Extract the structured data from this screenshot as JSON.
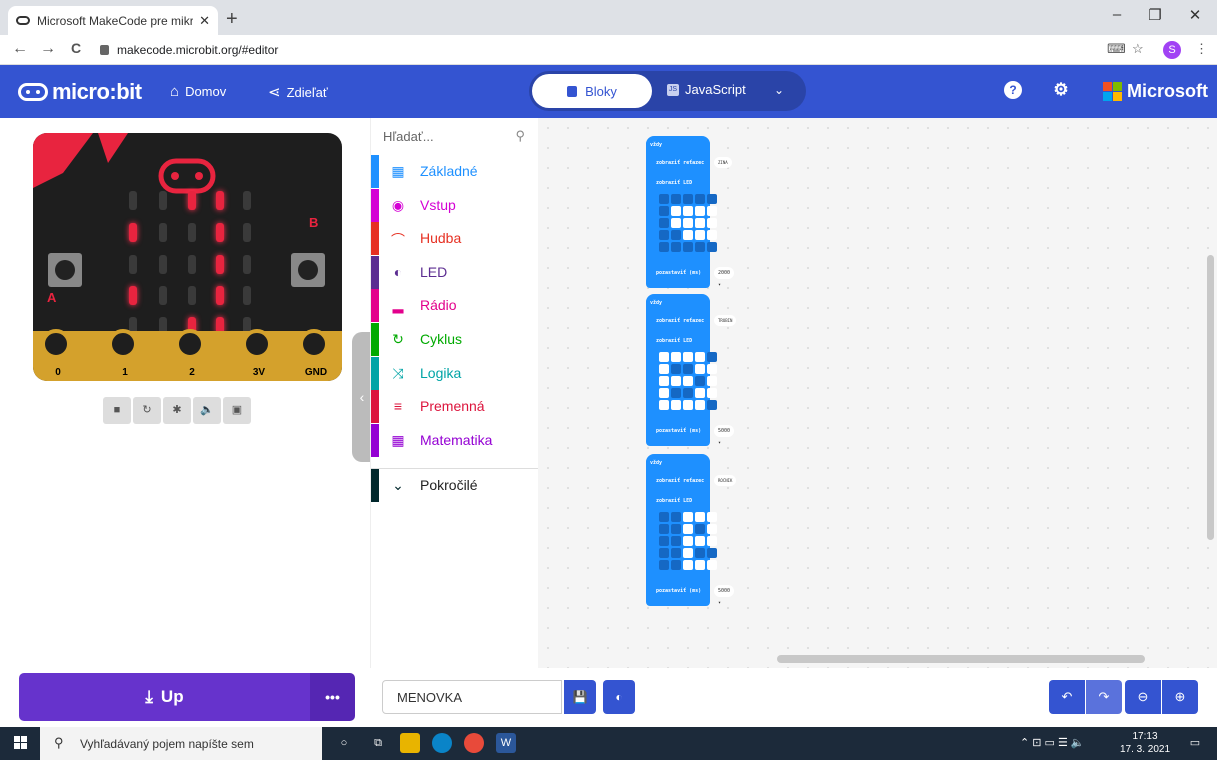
{
  "browser": {
    "tab_title": "Microsoft MakeCode pre mikro:",
    "tab_close": "✕",
    "new_tab": "+",
    "url": "makecode.microbit.org/#editor",
    "profile_initial": "S",
    "window": {
      "minimize": "–",
      "maximize": "❐",
      "close": "✕"
    },
    "nav": {
      "back": "←",
      "forward": "→",
      "reload": "C"
    }
  },
  "header": {
    "logo_text": "micro:bit",
    "home_label": "Domov",
    "share_label": "Zdieľať",
    "blocks_label": "Bloky",
    "javascript_label": "JavaScript",
    "help_icon": "?",
    "settings_icon": "gear-icon",
    "brand_label": "Microsoft",
    "accent_color": "#3454d1"
  },
  "simulator": {
    "button_a": "A",
    "button_b": "B",
    "pins": [
      "0",
      "1",
      "2",
      "3V",
      "GND"
    ],
    "led_matrix": [
      [
        0,
        0,
        1,
        1,
        0
      ],
      [
        1,
        0,
        0,
        1,
        0
      ],
      [
        0,
        0,
        0,
        1,
        0
      ],
      [
        1,
        0,
        0,
        1,
        0
      ],
      [
        0,
        0,
        1,
        1,
        0
      ]
    ],
    "controls": [
      "■",
      "↻",
      "✱",
      "🔈",
      "▣"
    ]
  },
  "toolbox": {
    "search_placeholder": "Hľadať...",
    "categories": [
      {
        "label": "Základné",
        "color": "#1e90ff",
        "icon": "grid-icon"
      },
      {
        "label": "Vstup",
        "color": "#d400d4",
        "icon": "target-icon"
      },
      {
        "label": "Hudba",
        "color": "#e63022",
        "icon": "headphones-icon"
      },
      {
        "label": "LED",
        "color": "#5c2d91",
        "icon": "toggle-icon"
      },
      {
        "label": "Rádio",
        "color": "#e3008c",
        "icon": "signal-icon"
      },
      {
        "label": "Cyklus",
        "color": "#00aa00",
        "icon": "loop-icon"
      },
      {
        "label": "Logika",
        "color": "#00a4a6",
        "icon": "shuffle-icon"
      },
      {
        "label": "Premenná",
        "color": "#dc143c",
        "icon": "lines-icon"
      },
      {
        "label": "Matematika",
        "color": "#9400d3",
        "icon": "calculator-icon"
      },
      {
        "label": "Pokročilé",
        "color": "#00272b",
        "icon": "chevron-down-icon"
      }
    ]
  },
  "workspace": {
    "blocks": [
      {
        "hat": "vždy",
        "show_string_label": "zobraziť reťazec",
        "string": "ZINA",
        "show_leds_label": "zobraziť LED",
        "leds": [
          [
            0,
            0,
            0,
            0,
            0
          ],
          [
            0,
            1,
            1,
            1,
            1
          ],
          [
            0,
            1,
            1,
            1,
            1
          ],
          [
            0,
            0,
            1,
            1,
            1
          ],
          [
            0,
            0,
            0,
            0,
            0
          ]
        ],
        "pause_label": "pozastaviť (ms)",
        "pause_value": "2000"
      },
      {
        "hat": "vždy",
        "show_string_label": "zobraziť reťazec",
        "string": "TRUBIN",
        "show_leds_label": "zobraziť LED",
        "leds": [
          [
            1,
            1,
            1,
            1,
            0
          ],
          [
            1,
            0,
            0,
            1,
            1
          ],
          [
            1,
            1,
            1,
            0,
            1
          ],
          [
            1,
            0,
            0,
            1,
            1
          ],
          [
            1,
            1,
            1,
            1,
            0
          ]
        ],
        "pause_label": "pozastaviť (ms)",
        "pause_value": "5000"
      },
      {
        "hat": "vždy",
        "show_string_label": "zobraziť reťazec",
        "string": "ROCNIK",
        "show_leds_label": "zobraziť LED",
        "leds": [
          [
            0,
            0,
            1,
            1,
            1
          ],
          [
            0,
            0,
            1,
            0,
            1
          ],
          [
            0,
            0,
            1,
            1,
            1
          ],
          [
            0,
            0,
            1,
            0,
            0
          ],
          [
            0,
            0,
            1,
            1,
            1
          ]
        ],
        "pause_label": "pozastaviť (ms)",
        "pause_value": "5000"
      }
    ]
  },
  "bottom": {
    "download_label": "Up",
    "more_label": "•••",
    "project_name": "MENOVKA"
  },
  "taskbar": {
    "search_placeholder": "Vyhľadávaný pojem napíšte sem",
    "time": "17:13",
    "date": "17. 3. 2021"
  }
}
